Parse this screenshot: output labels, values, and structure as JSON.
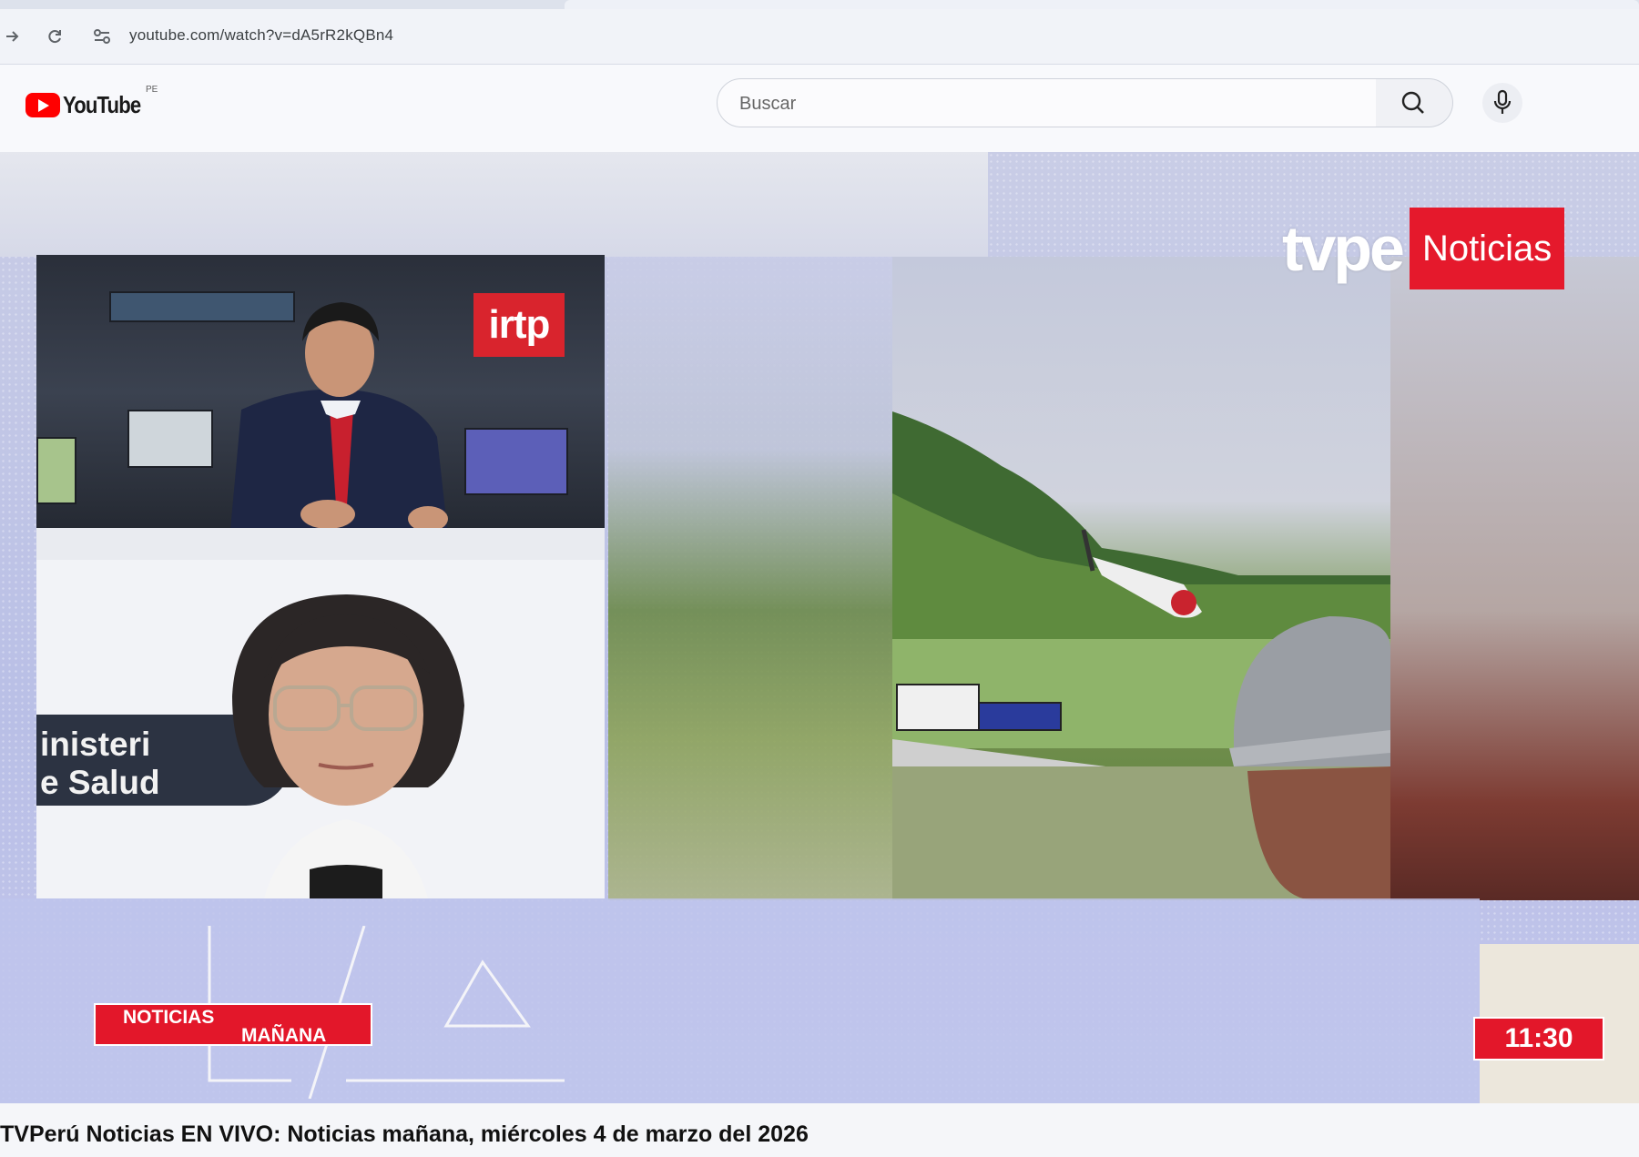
{
  "browser": {
    "url": "youtube.com/watch?v=dA5rR2kQBn4",
    "forward_icon": "arrow-right-icon",
    "reload_icon": "reload-icon",
    "site_info_icon": "tune-icon"
  },
  "masthead": {
    "logo_text": "YouTube",
    "country_code": "PE",
    "search_placeholder": "Buscar",
    "search_icon": "search-icon",
    "mic_icon": "microphone-icon"
  },
  "video": {
    "studio_logo": "irtp",
    "channel_logo_left": "tvpe",
    "channel_logo_right": "Noticias",
    "guest_banner_line1": "inisteri",
    "guest_banner_line2": "e  Salud",
    "program_line1": "NOTICIAS",
    "program_line2": "MAÑANA",
    "clock": "11:30"
  },
  "title": "TVPerú Noticias EN VIVO: Noticias mañana, miércoles 4 de marzo del 2026",
  "colors": {
    "brand_red": "#e3172a",
    "youtube_red": "#ff0000",
    "player_tint": "#b9bfe6"
  }
}
